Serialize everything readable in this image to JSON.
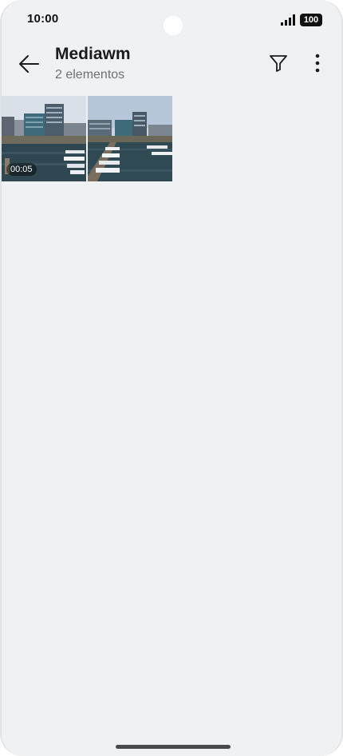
{
  "status_bar": {
    "time": "10:00",
    "battery": "100",
    "signal_icon": "signal-icon"
  },
  "header": {
    "title": "Mediawm",
    "subtitle": "2 elementos",
    "back_icon": "arrow-left-icon",
    "filter_icon": "filter-icon",
    "more_icon": "more-vertical-icon"
  },
  "media": [
    {
      "type": "video",
      "duration": "00:05"
    },
    {
      "type": "photo"
    }
  ]
}
